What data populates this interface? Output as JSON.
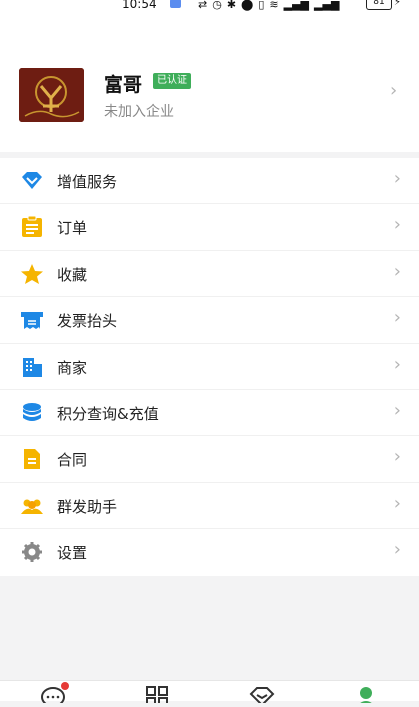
{
  "status_bar": {
    "time": "10:54",
    "battery": "81"
  },
  "profile": {
    "name": "富哥",
    "verified_badge": "已认证",
    "company": "未加入企业"
  },
  "menu": [
    {
      "label": "增值服务",
      "icon": "diamond-icon",
      "color": "#1e88e5"
    },
    {
      "label": "订单",
      "icon": "clipboard-icon",
      "color": "#f5b400"
    },
    {
      "label": "收藏",
      "icon": "star-icon",
      "color": "#f5b400"
    },
    {
      "label": "发票抬头",
      "icon": "invoice-icon",
      "color": "#1e88e5"
    },
    {
      "label": "商家",
      "icon": "building-icon",
      "color": "#1e88e5"
    },
    {
      "label": "积分查询&充值",
      "icon": "coins-icon",
      "color": "#1e88e5"
    },
    {
      "label": "合同",
      "icon": "document-icon",
      "color": "#f5b400"
    },
    {
      "label": "群发助手",
      "icon": "group-icon",
      "color": "#f5b400"
    },
    {
      "label": "设置",
      "icon": "gear-icon",
      "color": "#888888"
    }
  ],
  "tabbar": {
    "tabs": [
      {
        "icon": "chat-icon",
        "has_notification": true
      },
      {
        "icon": "apps-grid-icon"
      },
      {
        "icon": "diamond-outline-icon"
      },
      {
        "icon": "profile-icon",
        "active": true
      }
    ]
  }
}
